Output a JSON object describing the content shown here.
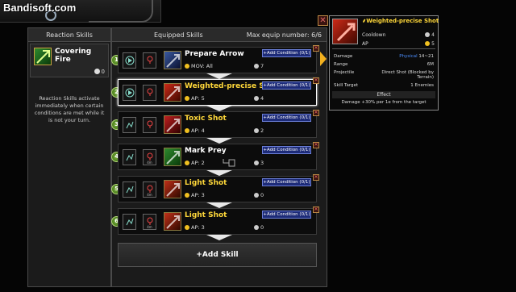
{
  "watermark": "Bandisoft.com",
  "reaction": {
    "title": "Reaction Skills",
    "skill_name": "Covering Fire",
    "skill_count": "0",
    "description": "Reaction Skills activate immediately when certain conditions are met while it is not your turn."
  },
  "equipped": {
    "title": "Equipped Skills",
    "max_equip_label": "Max equip number: 6/6",
    "add_skill_label": "+Add Skill",
    "rows": [
      {
        "num": "1",
        "name": "Prepare Arrow",
        "stat": "MOV: All",
        "cooldown": "7",
        "condition": "+Add Condition (0/1)",
        "range_label": "",
        "color": "#ffffff"
      },
      {
        "num": "2",
        "name": "Weighted-precise Shot",
        "stat": "AP: 5",
        "cooldown": "4",
        "condition": "+Add Condition (0/1)",
        "range_label": "",
        "color": "#ffd83a"
      },
      {
        "num": "3",
        "name": "Toxic Shot",
        "stat": "AP: 4",
        "cooldown": "2",
        "condition": "+Add Condition (0/1)",
        "range_label": "",
        "color": "#ffd83a"
      },
      {
        "num": "4",
        "name": "Mark Prey",
        "stat": "AP: 2",
        "cooldown": "3",
        "condition": "+Add Condition (0/1)",
        "range_label": "4m",
        "color": "#ffffff"
      },
      {
        "num": "5",
        "name": "Light Shot",
        "stat": "AP: 3",
        "cooldown": "0",
        "condition": "+Add Condition (0/1)",
        "range_label": "4m",
        "color": "#ffd83a"
      },
      {
        "num": "6",
        "name": "Light Shot",
        "stat": "AP: 3",
        "cooldown": "0",
        "condition": "+Add Condition (0/1)",
        "range_label": "4m",
        "color": "#ffd83a"
      }
    ]
  },
  "tooltip": {
    "name": "Weighted-precise Shot",
    "cooldown_label": "Cooldown",
    "cooldown_value": "4",
    "ap_label": "AP",
    "ap_value": "5",
    "damage_label": "Damage",
    "damage_type": "Physical",
    "damage_value": "14~21",
    "range_label": "Range",
    "range_value": "6M",
    "projectile_label": "Projectile",
    "projectile_value": "Direct Shot (Blocked by Terrain)",
    "target_label": "Skill Target",
    "target_value": "1 Enemies",
    "effect_header": "Effect",
    "effect_value": "Damage +30% per 1e from the target"
  },
  "colors": {
    "accent": "#ffd83a",
    "condition_button": "#1d2b78",
    "order_badge": "#5a8f26",
    "selection_pointer": "#f2b01e"
  }
}
